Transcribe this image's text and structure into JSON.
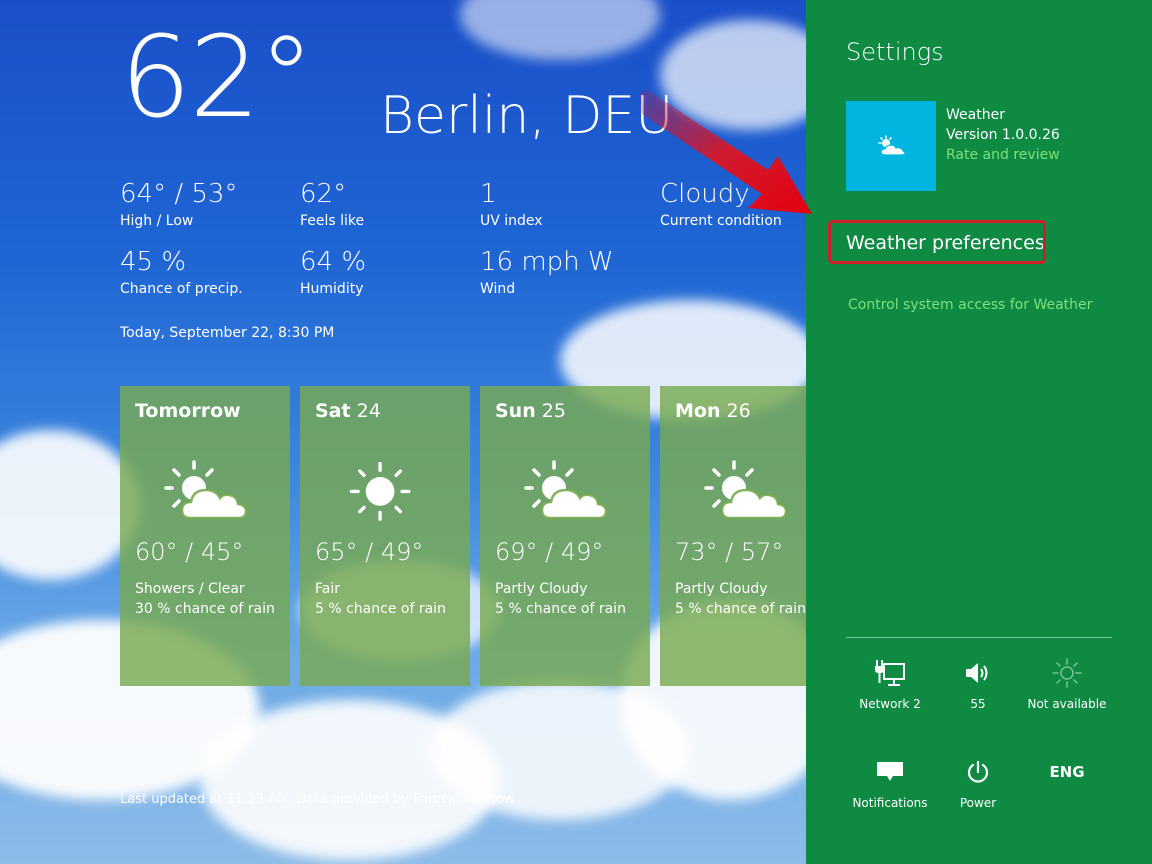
{
  "current": {
    "temperature": "62°",
    "city": "Berlin, DEU",
    "stats": [
      {
        "value": "64° / 53°",
        "label": "High / Low"
      },
      {
        "value": "62°",
        "label": "Feels like"
      },
      {
        "value": "1",
        "label": "UV index"
      },
      {
        "value": "Cloudy",
        "label": "Current condition"
      },
      {
        "value": "45 %",
        "label": "Chance of precip."
      },
      {
        "value": "64 %",
        "label": "Humidity"
      },
      {
        "value": "16 mph W",
        "label": "Wind"
      }
    ],
    "date": "Today, September 22, 8:30 PM"
  },
  "forecast": [
    {
      "day": "Tomorrow",
      "date": "",
      "range": "60° / 45°",
      "condition": "Showers / Clear",
      "rain": "30 % chance of rain",
      "icon": "partly-cloudy-icon"
    },
    {
      "day": "Sat",
      "date": "24",
      "range": "65° / 49°",
      "condition": "Fair",
      "rain": "5 % chance of rain",
      "icon": "sun-icon"
    },
    {
      "day": "Sun",
      "date": "25",
      "range": "69° / 49°",
      "condition": "Partly Cloudy",
      "rain": "5 % chance of rain",
      "icon": "partly-cloudy-icon"
    },
    {
      "day": "Mon",
      "date": "26",
      "range": "73° / 57°",
      "condition": "Partly Cloudy",
      "rain": "5 % chance of rain",
      "icon": "partly-cloudy-icon"
    }
  ],
  "footer": {
    "updated": "Last updated at 11:23 AM. Data provided by Foreca, AIRNow"
  },
  "charm": {
    "title": "Settings",
    "app_name": "Weather",
    "version": "Version 1.0.0.26",
    "rate": "Rate and review",
    "preferences": "Weather preferences",
    "control": "Control system access for Weather",
    "quick_settings": [
      {
        "label": "Network  2",
        "icon": "network-icon"
      },
      {
        "label": "55",
        "icon": "volume-icon"
      },
      {
        "label": "Not available",
        "icon": "brightness-icon"
      },
      {
        "label": "Notifications",
        "icon": "notifications-icon"
      },
      {
        "label": "Power",
        "icon": "power-icon"
      },
      {
        "label": "",
        "icon": "keyboard-language-icon",
        "text": "ENG"
      }
    ]
  },
  "colors": {
    "charm_bg": "#0e8a43",
    "tile_bg": "#00b6e0",
    "link_green": "#7ee07a",
    "highlight_red": "#d11d2a",
    "card_bg": "#78aa50"
  }
}
